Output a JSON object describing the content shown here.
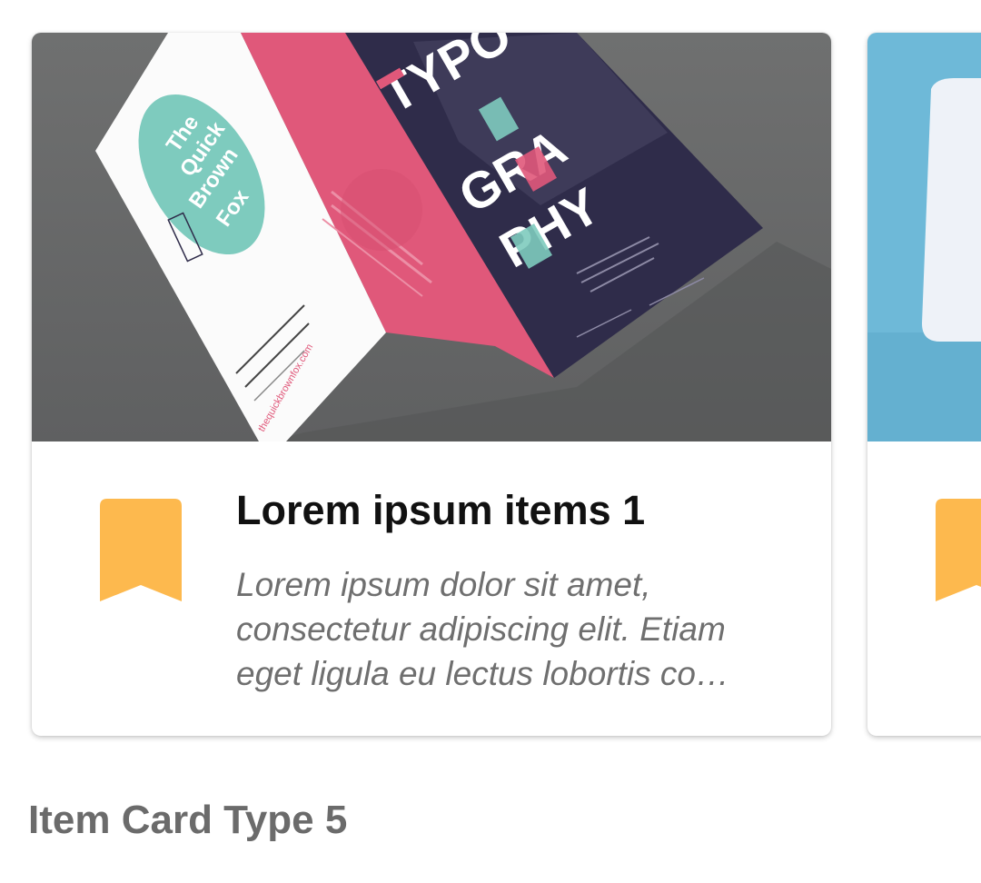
{
  "cards": [
    {
      "title": "Lorem ipsum items 1",
      "description": "Lorem ipsum dolor sit amet, consectetur adipiscing elit. Etiam eget ligula eu lectus lobortis co…",
      "image": {
        "brochure_circle_lines": [
          "The",
          "Quick",
          "Brown",
          "Fox"
        ],
        "brochure_website": "thequickbrownfox.com",
        "brochure_word_lines": [
          "TYPO",
          "GRA",
          "PHY"
        ]
      },
      "icon": "bookmark-icon"
    },
    {
      "title": "",
      "description": "",
      "icon": "bookmark-icon"
    }
  ],
  "section_title": "Item Card Type 5",
  "colors": {
    "bookmark": "#FDB94E",
    "title": "#111111",
    "description": "#6F6F6F",
    "section_title": "#6B6B6B",
    "photo_background": "#6F7070",
    "brochure_pink": "#E0587A",
    "brochure_navy": "#2F2C4A",
    "brochure_teal": "#7ECBBE",
    "second_card_background": "#6EB9D8"
  }
}
